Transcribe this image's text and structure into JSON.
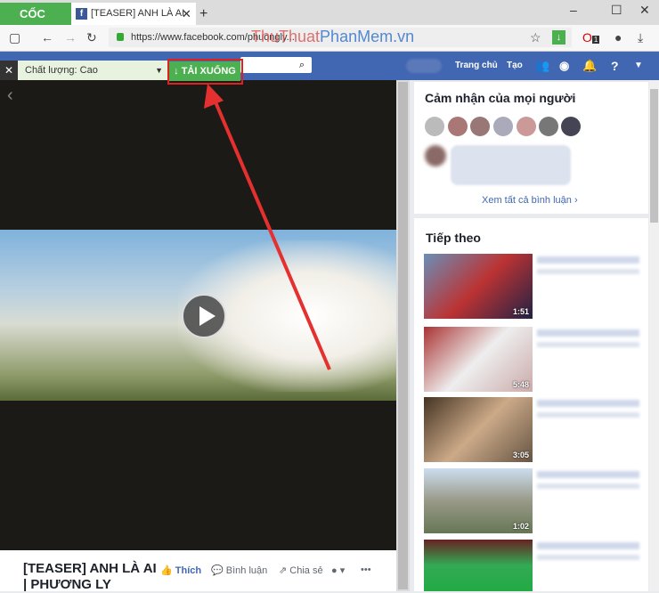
{
  "browser": {
    "brand": "CỐC CỐC",
    "tab_title": "[TEASER] ANH LÀ AI",
    "url": "https://www.facebook.com/phuongly...",
    "watermark_a": "ThuThuat",
    "watermark_b": "PhanMem.vn",
    "badge": "1"
  },
  "facebook": {
    "nav_home": "Trang chủ",
    "nav_create": "Tạo"
  },
  "downloader": {
    "quality": "Chất lượng: Cao",
    "download_label": "↓ TẢI XUỐNG"
  },
  "video": {
    "title": "[TEASER] ANH LÀ AI | PHƯƠNG LY",
    "like": "Thích",
    "comment": "Bình luận",
    "share": "Chia sẻ",
    "more": "•••"
  },
  "sidebar": {
    "reactions_title": "Cảm nhận của mọi người",
    "see_all": "Xem tất cả bình luận",
    "next_title": "Tiếp theo",
    "next_videos": [
      {
        "duration": "1:51"
      },
      {
        "duration": "5:48"
      },
      {
        "duration": "3:05"
      },
      {
        "duration": "1:02"
      },
      {
        "duration": ""
      }
    ]
  }
}
